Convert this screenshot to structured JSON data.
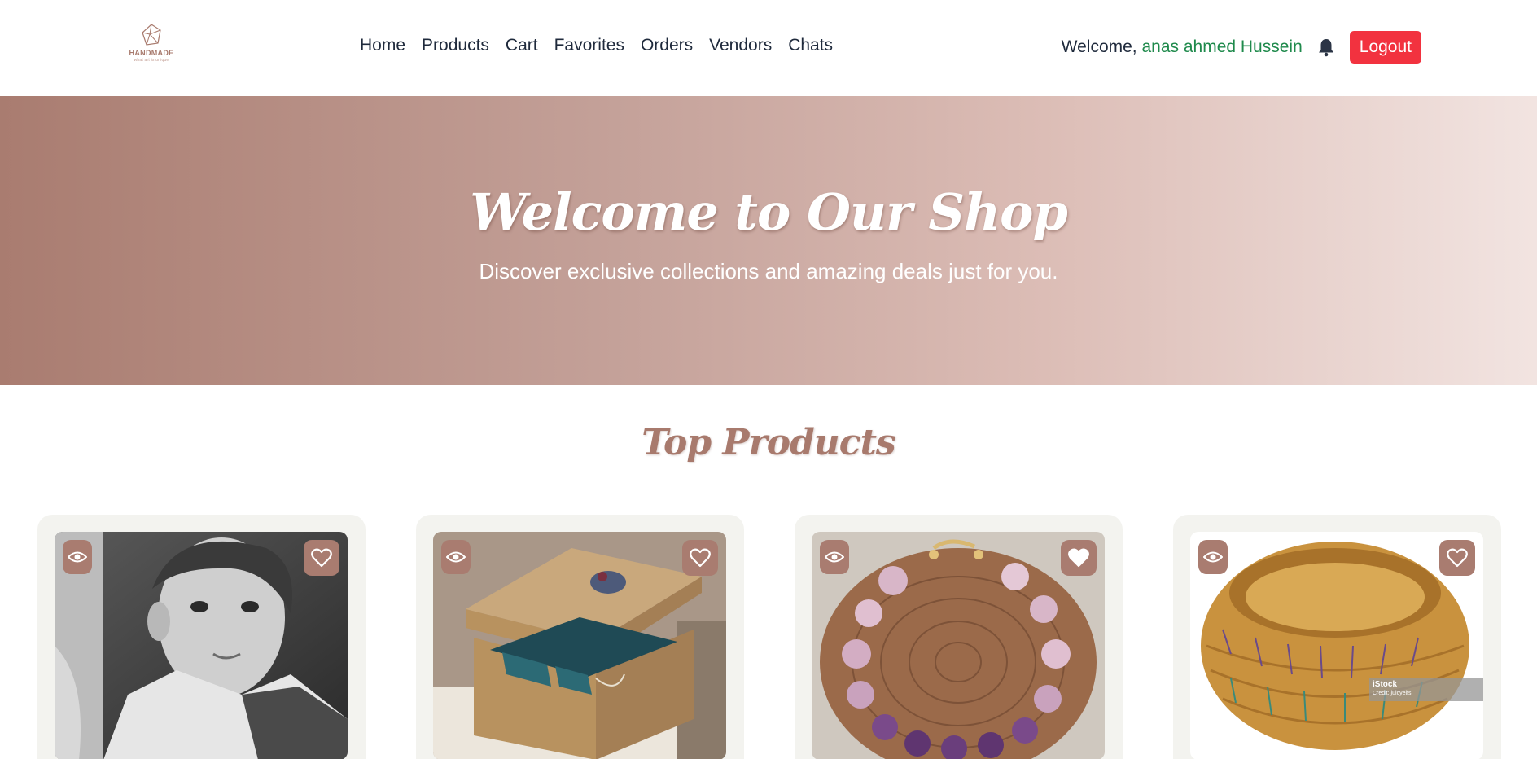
{
  "logo": {
    "brand": "HANDMADE",
    "tagline": "what art is unique"
  },
  "nav": {
    "links": [
      "Home",
      "Products",
      "Cart",
      "Favorites",
      "Orders",
      "Vendors",
      "Chats"
    ]
  },
  "user": {
    "welcome_prefix": "Welcome, ",
    "name": "anas ahmed Hussein",
    "logout_label": "Logout"
  },
  "hero": {
    "title": "Welcome to Our Shop",
    "subtitle": "Discover exclusive collections and amazing deals just for you."
  },
  "top_products": {
    "title": "Top Products",
    "items": [
      {
        "image": "boy-portrait-photo",
        "favorited": false
      },
      {
        "image": "wooden-jewelry-box-photo",
        "favorited": false
      },
      {
        "image": "amethyst-bracelet-photo",
        "favorited": true
      },
      {
        "image": "woven-basket-photo",
        "favorited": false,
        "watermark": "iStock",
        "watermark_credit": "Credit: juicyelfs"
      }
    ]
  },
  "icons": {
    "bell": "bell-icon",
    "view": "eye-icon",
    "favorite": "heart-icon"
  },
  "colors": {
    "accent": "#a97c70",
    "logout": "#f2323f",
    "username": "#1f8a4c",
    "card_bg": "#f3f3ef"
  }
}
